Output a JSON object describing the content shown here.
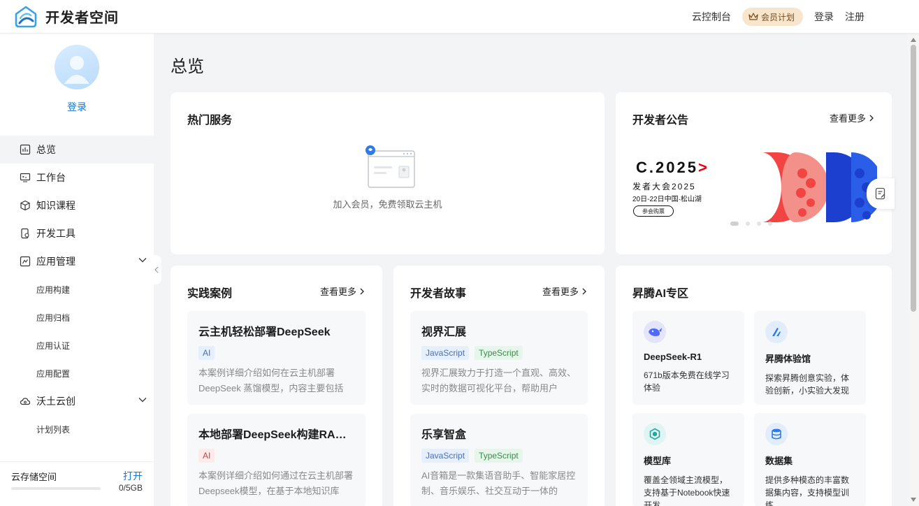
{
  "header": {
    "brand": "开发者空间",
    "console": "云控制台",
    "vip": "会员计划",
    "login": "登录",
    "register": "注册"
  },
  "sidebar": {
    "login": "登录",
    "items": [
      {
        "label": "总览"
      },
      {
        "label": "工作台"
      },
      {
        "label": "知识课程"
      },
      {
        "label": "开发工具"
      },
      {
        "label": "应用管理"
      },
      {
        "label": "沃土云创"
      }
    ],
    "app_sub": [
      "应用构建",
      "应用归档",
      "应用认证",
      "应用配置"
    ],
    "wotu_sub": [
      "计划列表"
    ],
    "storage": {
      "label": "云存储空间",
      "open": "打开",
      "value": "0/5GB",
      "fraction": 0
    }
  },
  "main": {
    "title": "总览",
    "hot": {
      "title": "热门服务",
      "empty": "加入会员，免费领取云主机"
    },
    "notice": {
      "title": "开发者公告",
      "more": "查看更多",
      "banner": {
        "headline": "C.2025",
        "arrow": ">",
        "sub": "发者大会2025",
        "date": "20日-22日中国·松山湖",
        "button": "参会购票"
      }
    },
    "cases": {
      "title": "实践案例",
      "more": "查看更多",
      "items": [
        {
          "title": "云主机轻松部署DeepSeek",
          "tags": [
            "AI"
          ],
          "desc": "本案例详细介绍如何在云主机部署DeepSeek 蒸馏模型，内容主要包括DeepSeek"
        },
        {
          "title": "本地部署DeepSeek构建RAG应用",
          "tags": [
            "AI"
          ],
          "desc": "本案例详细介绍如何通过在云主机部署Deepseek模型，在基于本地知识库"
        }
      ]
    },
    "stories": {
      "title": "开发者故事",
      "more": "查看更多",
      "items": [
        {
          "title": "视界汇展",
          "tags": [
            "JavaScript",
            "TypeScript"
          ],
          "desc": "视界汇展致力于打造一个直观、高效、实时的数据可视化平台，帮助用户"
        },
        {
          "title": "乐享智盒",
          "tags": [
            "JavaScript",
            "TypeScript"
          ],
          "desc": "AI音箱是一款集语音助手、智能家居控制、音乐娱乐、社交互动于一体的"
        }
      ]
    },
    "ai": {
      "title": "昇腾AI专区",
      "tiles": [
        {
          "title": "DeepSeek-R1",
          "desc": "671b版本免费在线学习体验"
        },
        {
          "title": "昇腾体验馆",
          "desc": "探索昇腾创意实验，体验创新，小实验大发现"
        },
        {
          "title": "模型库",
          "desc": "覆盖全领域主流模型，支持基于Notebook快速开发"
        },
        {
          "title": "数据集",
          "desc": "提供多种模态的丰富数据集内容，支持模型训练"
        }
      ]
    }
  },
  "colors": {
    "accent": "#1478d4",
    "vip_bg": "#f7e6cc",
    "page_bg": "#f3f4f6"
  }
}
